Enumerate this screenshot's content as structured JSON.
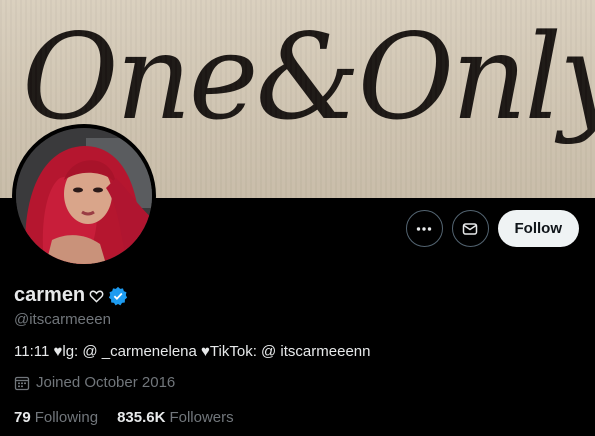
{
  "banner": {
    "text": "One&Only"
  },
  "profile": {
    "name": "carmen",
    "handle": "@itscarmeeen",
    "bio": "11:11 ♥lg: @ _carmenelena ♥TikTok: @ itscarmeeenn",
    "joined": "Joined October 2016"
  },
  "actions": {
    "follow_label": "Follow"
  },
  "stats": [
    {
      "value": "79",
      "label": "Following"
    },
    {
      "value": "835.6K",
      "label": "Followers"
    }
  ],
  "colors": {
    "background": "#000000",
    "verified": "#1d9bf0",
    "secondary_text": "#71767b",
    "follow_button": "#eff3f4"
  },
  "icons": [
    "more-icon",
    "message-icon",
    "heart-outline-icon",
    "verified-badge-icon",
    "calendar-icon"
  ]
}
